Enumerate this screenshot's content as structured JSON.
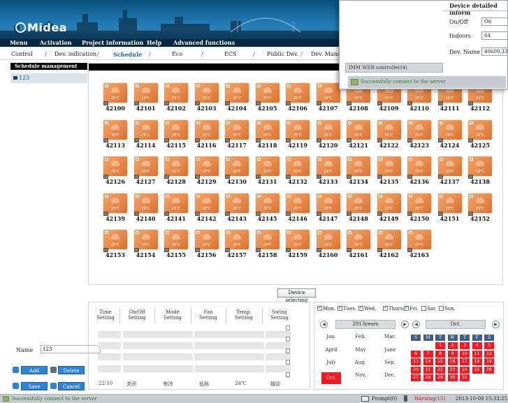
{
  "brand": {
    "logo": "Midea"
  },
  "top_menu": [
    "Menu",
    "Activation",
    "Project information",
    "Help",
    "Advanced functions"
  ],
  "sub_nav": [
    "Control",
    "Dev. indication",
    "Schedule",
    "Eco",
    "ECS",
    "Public Dev.",
    "Dev. Mana"
  ],
  "sub_nav_active": "Schedule",
  "left_panel": {
    "title": "Schedule management",
    "tree_item": "123",
    "name_label": "Name",
    "name_value": "123",
    "buttons": {
      "add": "Add",
      "delete": "Delete",
      "save": "Save",
      "cancel": "Cancel"
    }
  },
  "devices": {
    "temp_label": "25℃",
    "ids": [
      "42100",
      "42101",
      "42102",
      "42103",
      "42104",
      "42105",
      "42106",
      "42107",
      "42108",
      "42109",
      "42110",
      "42111",
      "42112",
      "42113",
      "42114",
      "42115",
      "42116",
      "42117",
      "42118",
      "42119",
      "42120",
      "42121",
      "42122",
      "42123",
      "42124",
      "42125",
      "42126",
      "42127",
      "42128",
      "42129",
      "42130",
      "42131",
      "42132",
      "42133",
      "42134",
      "42135",
      "42136",
      "42137",
      "42138",
      "42139",
      "42140",
      "42141",
      "42142",
      "42143",
      "42145",
      "42146",
      "42147",
      "42148",
      "42149",
      "42150",
      "42151",
      "42152",
      "42153",
      "42154",
      "42155",
      "42156",
      "42157",
      "42158",
      "42159",
      "42160",
      "42161",
      "42162",
      "42163"
    ]
  },
  "device_selecting_button": "Device selecting",
  "schedule_table": {
    "headers": [
      "Time\nSetting",
      "On/Off\nSetting",
      "Mode\nSetting",
      "Fan\nSetting",
      "Temp.\nSetting",
      "Swing\nSetting"
    ],
    "last_row": [
      "22:10",
      "关闭",
      "制冷",
      "低档",
      "24℃",
      "摆动"
    ]
  },
  "weekdays": [
    {
      "label": "Mon.",
      "checked": true
    },
    {
      "label": "Tues.",
      "checked": true
    },
    {
      "label": "Wed.",
      "checked": true
    },
    {
      "label": "Thurs.",
      "checked": true
    },
    {
      "label": "Fri.",
      "checked": true
    },
    {
      "label": "Sat.",
      "checked": false
    },
    {
      "label": "Sun.",
      "checked": false
    }
  ],
  "year_picker": {
    "year": "2013years",
    "months": [
      "Jan.",
      "Feb.",
      "Mar.",
      "April",
      "May",
      "June",
      "July",
      "Aug.",
      "Sep.",
      "Oct.",
      "Nov.",
      "Dec."
    ],
    "selected": "Oct."
  },
  "month_picker": {
    "month": "Oct.",
    "day_headers": [
      "S",
      "M",
      "T",
      "W",
      "T",
      "F",
      "S"
    ],
    "days": [
      "1",
      "2",
      "3",
      "4",
      "5",
      "6",
      "7",
      "8",
      "9",
      "10",
      "11",
      "12",
      "13",
      "14",
      "15",
      "16",
      "17",
      "18",
      "19",
      "20",
      "21",
      "22",
      "23",
      "24",
      "25",
      "26",
      "27",
      "28",
      "29",
      "30",
      "31"
    ]
  },
  "status_bar": {
    "message": "Successfully connect to the server",
    "prompt": "Prompt(0)",
    "warning": "Warning(15)",
    "datetime": "2013-10-09 15:33:25"
  },
  "popup": {
    "title": "Device detailed inform",
    "onoff_label": "On/Off",
    "onoff_value": "On",
    "indoors_label": "Indoors",
    "indoors_value": "64",
    "devname_label": "Dev. Name",
    "devname_value": "40600,33",
    "controller": "IMM WEB controller(4)",
    "status": "Successfully connect to the server"
  },
  "colors": {
    "banner": "#1f78b0",
    "device_orange": "#e8894a",
    "calendar_red": "#ee1c24",
    "calendar_header": "#3d5f88"
  }
}
